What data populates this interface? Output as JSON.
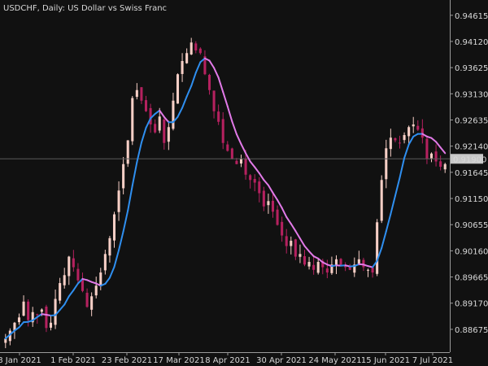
{
  "chart_data": {
    "type": "candlestick",
    "title": "USDCHF, Daily:  US Dollar vs Swiss Franc",
    "y_ticks": [
      "0.94615",
      "0.94120",
      "0.93625",
      "0.93130",
      "0.92635",
      "0.92140",
      "0.91645",
      "0.91150",
      "0.90655",
      "0.90160",
      "0.89665",
      "0.89170",
      "0.88675"
    ],
    "y_range": [
      0.8832,
      0.9475
    ],
    "x_ticks": [
      "8 Jan 2021",
      "1 Feb 2021",
      "23 Feb 2021",
      "17 Mar 2021",
      "8 Apr 2021",
      "30 Apr 2021",
      "24 May 2021",
      "15 Jun 2021",
      "7 Jul 2021"
    ],
    "current_price": "0.91900",
    "grid": false,
    "colors": {
      "background": "#111111",
      "up_candle": "#f7cfc6",
      "down_candle": "#b5215f",
      "ma_rising": "#2f8ff0",
      "ma_falling": "#e27ae8",
      "price_line": "#5b5b5b",
      "price_label_bg": "#c8c8c8",
      "axis": "#9a9a9a"
    },
    "close": [
      0.885,
      0.8865,
      0.888,
      0.889,
      0.892,
      0.8885,
      0.89,
      0.8895,
      0.8905,
      0.887,
      0.888,
      0.8925,
      0.8955,
      0.897,
      0.9005,
      0.8985,
      0.896,
      0.894,
      0.891,
      0.893,
      0.895,
      0.8975,
      0.901,
      0.904,
      0.9085,
      0.913,
      0.918,
      0.9225,
      0.9305,
      0.932,
      0.93,
      0.928,
      0.9255,
      0.924,
      0.927,
      0.922,
      0.925,
      0.93,
      0.935,
      0.9375,
      0.939,
      0.941,
      0.9395,
      0.939,
      0.935,
      0.932,
      0.928,
      0.926,
      0.922,
      0.9205,
      0.919,
      0.918,
      0.919,
      0.916,
      0.915,
      0.9145,
      0.9125,
      0.91,
      0.911,
      0.909,
      0.9065,
      0.9045,
      0.9025,
      0.9035,
      0.9005,
      0.901,
      0.899,
      0.8995,
      0.898,
      0.8995,
      0.8985,
      0.8975,
      0.899,
      0.9,
      0.899,
      0.8985,
      0.898,
      0.899,
      0.9,
      0.8985,
      0.898,
      0.8975,
      0.907,
      0.915,
      0.921,
      0.923,
      0.9225,
      0.922,
      0.9235,
      0.925,
      0.9255,
      0.9245,
      0.923,
      0.919,
      0.92,
      0.9185,
      0.9175,
      0.918
    ]
  }
}
